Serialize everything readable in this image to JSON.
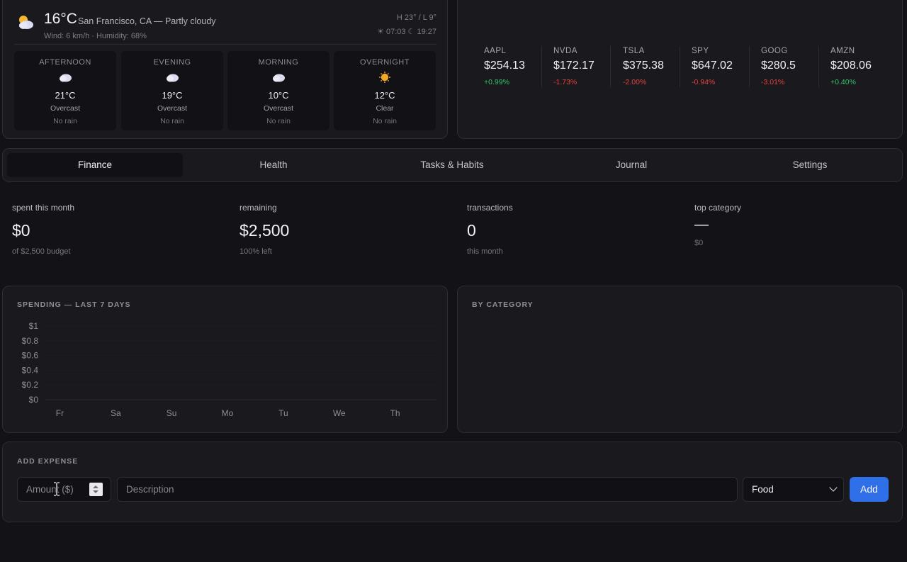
{
  "weather": {
    "temp": "16°C",
    "location": "San Francisco, CA — Partly cloudy",
    "details": "Wind: 6 km/h · Humidity: 68%",
    "high_low": "H 23° / L 9°",
    "sun": "☀ 07:03 ☾ 19:27",
    "icon": "partly-cloudy-icon",
    "forecast": [
      {
        "label": "AFTERNOON",
        "icon": "cloud-icon",
        "temp": "21°C",
        "condition": "Overcast",
        "rain": "No rain"
      },
      {
        "label": "EVENING",
        "icon": "cloud-icon",
        "temp": "19°C",
        "condition": "Overcast",
        "rain": "No rain"
      },
      {
        "label": "MORNING",
        "icon": "cloud-icon",
        "temp": "10°C",
        "condition": "Overcast",
        "rain": "No rain"
      },
      {
        "label": "OVERNIGHT",
        "icon": "sun-icon",
        "temp": "12°C",
        "condition": "Clear",
        "rain": "No rain"
      }
    ]
  },
  "stocks": [
    {
      "symbol": "AAPL",
      "price": "$254.13",
      "change": "+0.99%",
      "direction": "up"
    },
    {
      "symbol": "NVDA",
      "price": "$172.17",
      "change": "-1.73%",
      "direction": "down"
    },
    {
      "symbol": "TSLA",
      "price": "$375.38",
      "change": "-2.00%",
      "direction": "down"
    },
    {
      "symbol": "SPY",
      "price": "$647.02",
      "change": "-0.94%",
      "direction": "down"
    },
    {
      "symbol": "GOOG",
      "price": "$280.5",
      "change": "-3.01%",
      "direction": "down"
    },
    {
      "symbol": "AMZN",
      "price": "$208.06",
      "change": "+0.40%",
      "direction": "up"
    }
  ],
  "colors": {
    "up": "#35c46b",
    "down": "#e0453f",
    "accent": "#2f6fe8"
  },
  "tabs": [
    {
      "label": "Finance",
      "active": true
    },
    {
      "label": "Health",
      "active": false
    },
    {
      "label": "Tasks & Habits",
      "active": false
    },
    {
      "label": "Journal",
      "active": false
    },
    {
      "label": "Settings",
      "active": false
    }
  ],
  "summary": {
    "spent": {
      "label": "spent this month",
      "value": "$0",
      "sub": "of $2,500 budget"
    },
    "remaining": {
      "label": "remaining",
      "value": "$2,500",
      "sub": "100% left"
    },
    "transactions": {
      "label": "transactions",
      "value": "0",
      "sub": "this month"
    },
    "top_category": {
      "label": "top category",
      "value": "—",
      "sub": "$0"
    }
  },
  "spending_chart": {
    "title": "SPENDING — LAST 7 DAYS",
    "chart_data": {
      "type": "bar",
      "categories": [
        "Fr",
        "Sa",
        "Su",
        "Mo",
        "Tu",
        "We",
        "Th"
      ],
      "values": [
        0,
        0,
        0,
        0,
        0,
        0,
        0
      ],
      "ylim": [
        0,
        1
      ],
      "yticks": [
        "$0",
        "$0.2",
        "$0.4",
        "$0.6",
        "$0.8",
        "$1"
      ],
      "xlabel": "",
      "ylabel": "",
      "grid": true
    }
  },
  "category_chart": {
    "title": "BY CATEGORY"
  },
  "add_expense": {
    "title": "ADD EXPENSE",
    "amount_placeholder": "Amount ($)",
    "description_placeholder": "Description",
    "category_selected": "Food",
    "add_label": "Add"
  }
}
